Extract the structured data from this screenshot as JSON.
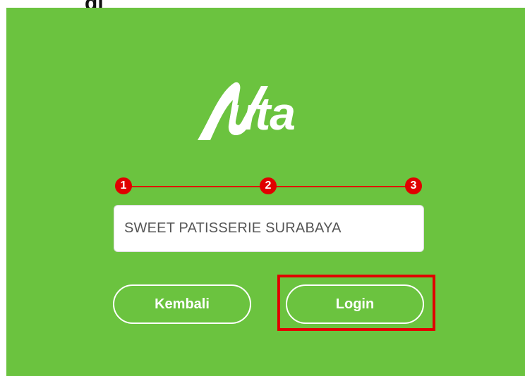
{
  "header_fragment": "gi",
  "brand": {
    "logo_text": "uta"
  },
  "stepper": {
    "steps": [
      "1",
      "2",
      "3"
    ],
    "color": "#e00000"
  },
  "store_field": {
    "value": "SWEET PATISSERIE SURABAYA"
  },
  "buttons": {
    "back_label": "Kembali",
    "login_label": "Login"
  },
  "colors": {
    "background": "#6bc33f",
    "accent": "#e00000",
    "text_on_bg": "#ffffff"
  }
}
